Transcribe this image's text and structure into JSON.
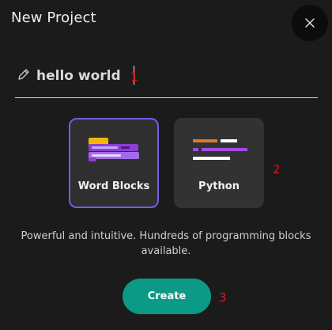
{
  "dialog": {
    "title": "New Project"
  },
  "name_field": {
    "value": "hello world",
    "icon": "pencil-icon"
  },
  "close_button": {
    "icon": "close-icon",
    "glyph": "✕"
  },
  "project_types": [
    {
      "label": "Word Blocks",
      "icon": "word-blocks-icon",
      "selected": true
    },
    {
      "label": "Python",
      "icon": "python-code-icon",
      "selected": false
    }
  ],
  "description": "Powerful and intuitive. Hundreds of programming blocks available.",
  "create_button": {
    "label": "Create"
  },
  "annotations": {
    "marker_1": "1",
    "marker_2": "2",
    "marker_3": "3"
  },
  "colors": {
    "background": "#1b1b1b",
    "selected_border": "#7a59e6",
    "create_button": "#0a9a85",
    "marker": "#e0161c"
  }
}
